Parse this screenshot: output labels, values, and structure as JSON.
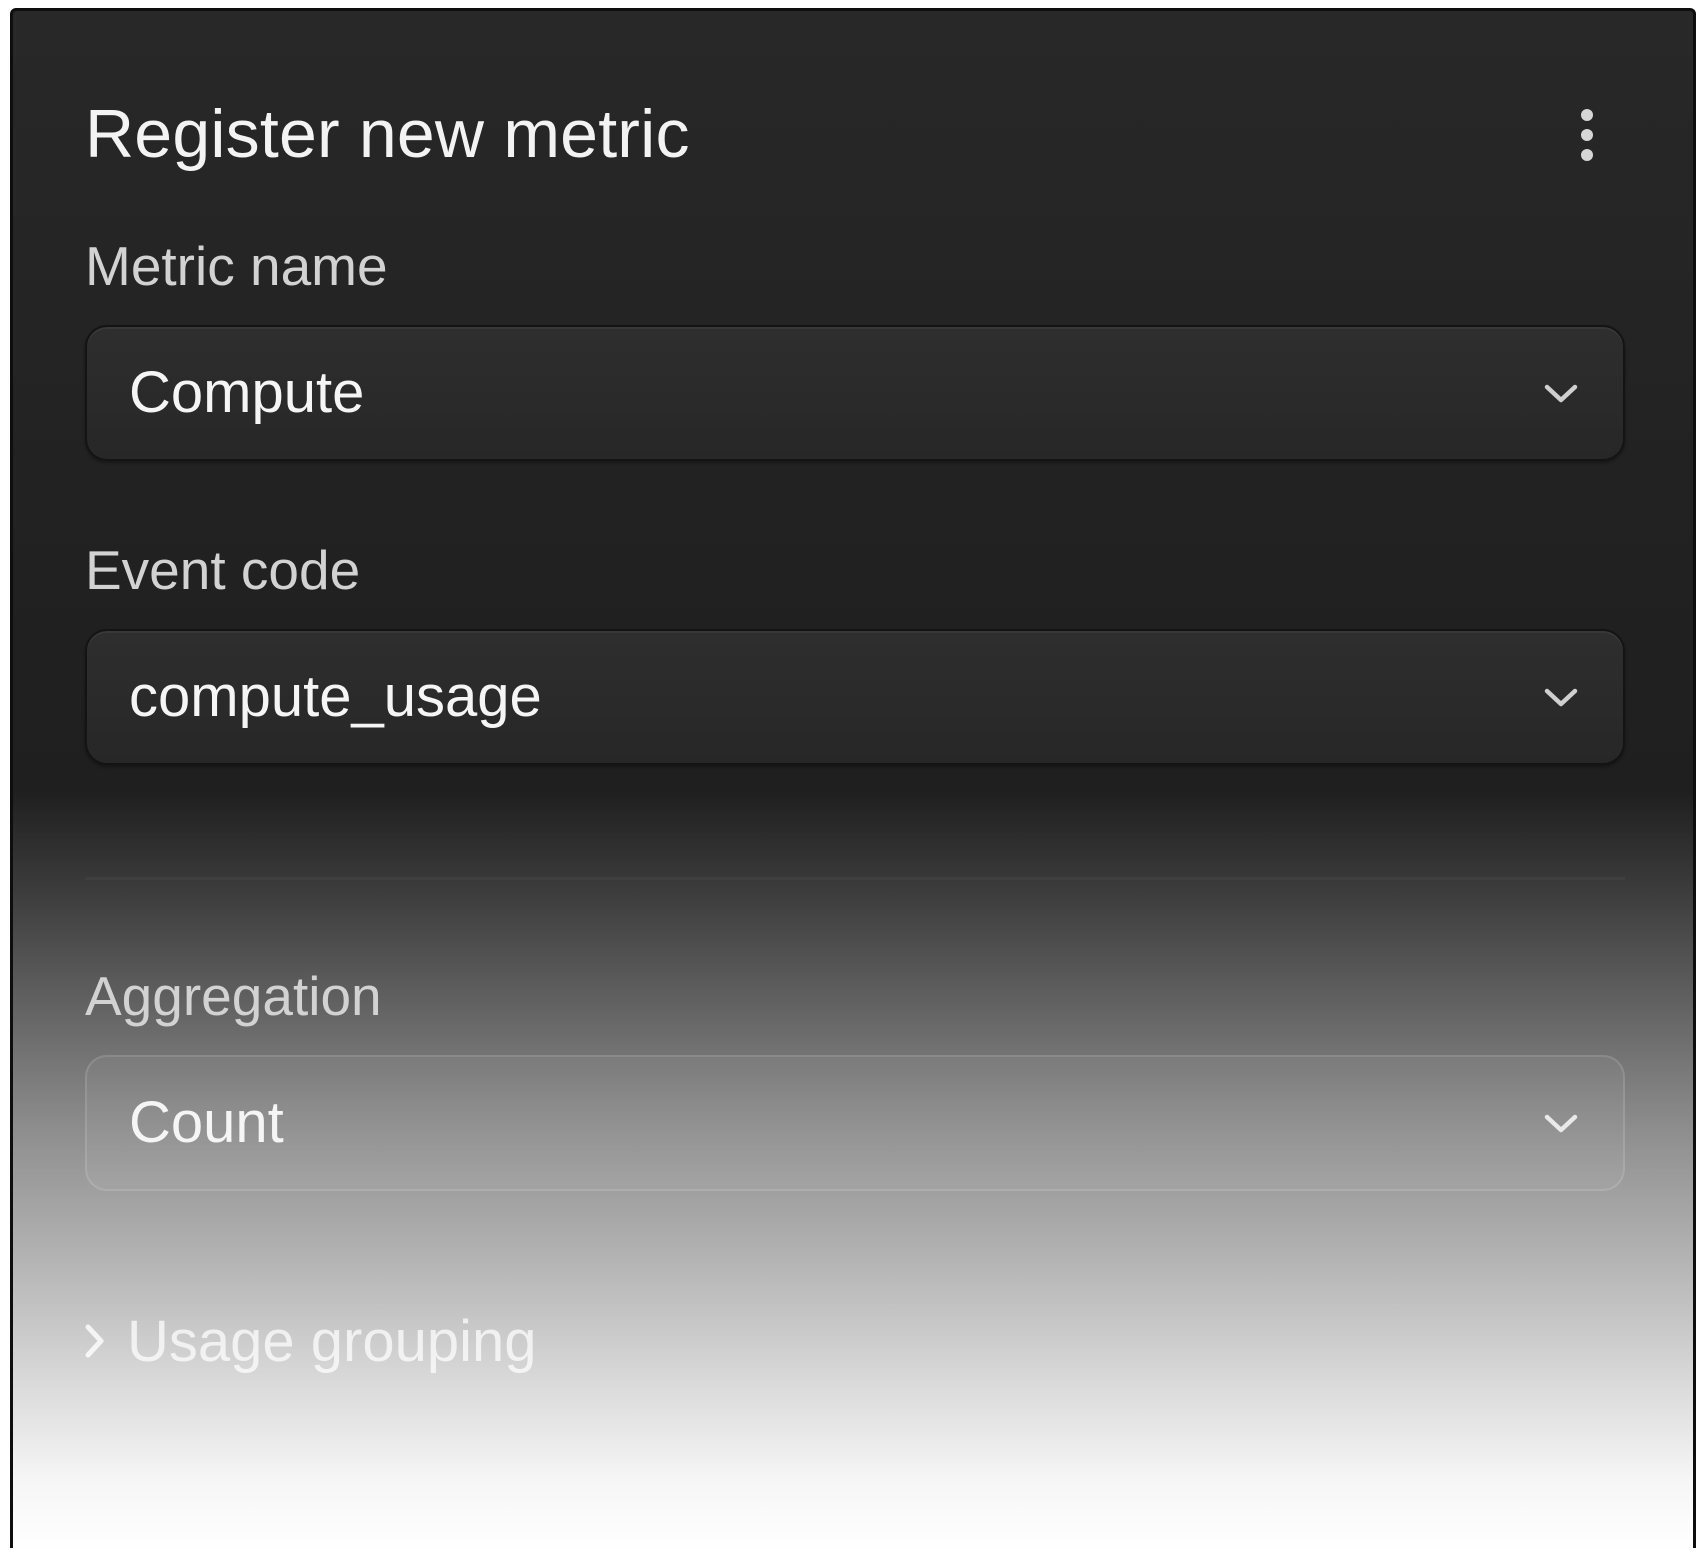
{
  "panel": {
    "title": "Register new metric",
    "menu_icon": "more-vertical-icon"
  },
  "fields": {
    "metric_name": {
      "label": "Metric name",
      "value": "Compute",
      "icon": "chevron-down-icon"
    },
    "event_code": {
      "label": "Event code",
      "value": "compute_usage",
      "icon": "chevron-down-icon"
    },
    "aggregation": {
      "label": "Aggregation",
      "value": "Count",
      "icon": "chevron-down-icon"
    }
  },
  "usage_grouping": {
    "label": "Usage grouping",
    "icon": "chevron-right-icon",
    "expanded": false
  },
  "colors": {
    "panel_top": "#282828",
    "text_primary": "#f3f3f3",
    "text_label": "#d2d2d2",
    "divider": "#3f3f3f"
  }
}
